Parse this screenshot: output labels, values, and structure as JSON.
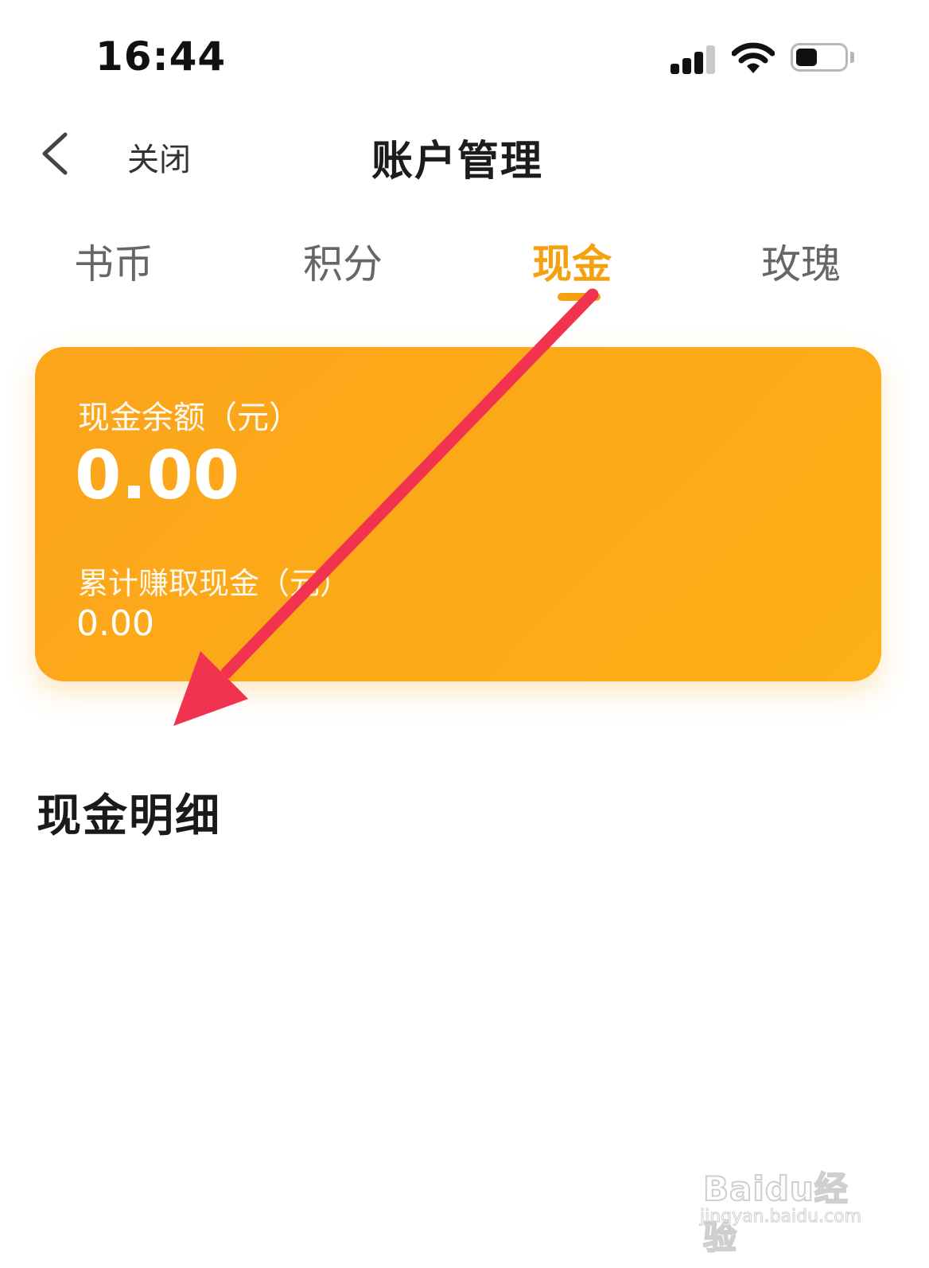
{
  "status_bar": {
    "time": "16:44"
  },
  "header": {
    "back_icon": "chevron-left-icon",
    "close_label": "关闭",
    "title": "账户管理"
  },
  "tabs": [
    {
      "label": "书币",
      "active": false
    },
    {
      "label": "积分",
      "active": false
    },
    {
      "label": "现金",
      "active": true
    },
    {
      "label": "玫瑰",
      "active": false
    }
  ],
  "card": {
    "balance_label": "现金余额（元）",
    "balance_value": "0.00",
    "earned_label": "累计赚取现金（元）",
    "earned_value": "0.00"
  },
  "section": {
    "title": "现金明细"
  },
  "watermark": {
    "logo": "Baidu经验",
    "url": "jingyan.baidu.com"
  },
  "colors": {
    "accent": "#f5a10f",
    "card": "#fca91a",
    "arrow": "#f2334f"
  }
}
